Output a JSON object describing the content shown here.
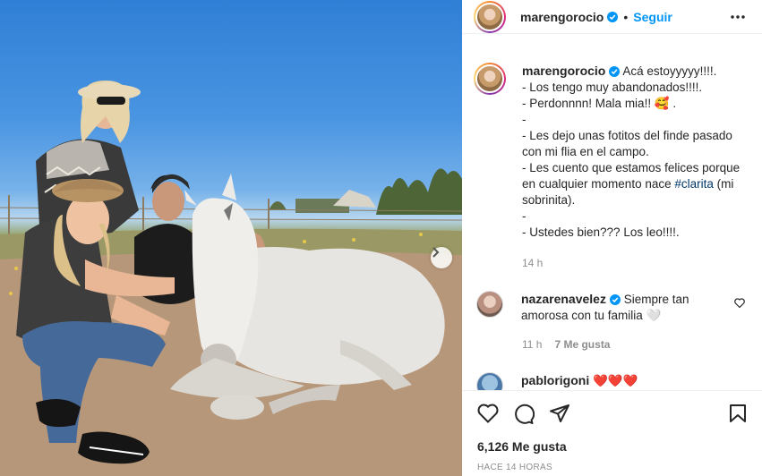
{
  "post": {
    "username": "marengorocio",
    "follow_label": "Seguir",
    "separator": "•",
    "caption_lines": [
      "Acá estoyyyyy!!!!.",
      "- Los tengo muy abandonados!!!!.",
      "- Perdonnnn! Mala mia!! 🥰 .",
      "-",
      "- Les dejo unas fotitos del finde pasado con mi flia en el campo.",
      "- Les cuento que estamos felices porque en cualquier momento nace ",
      "-",
      "- Ustedes bien??? Los leo!!!!."
    ],
    "hashtag": "#clarita",
    "caption_after_hashtag": " (mi sobrinita).",
    "caption_time": "14 h"
  },
  "comments": [
    {
      "username": "nazarenavelez",
      "text": "Siempre tan amorosa con tu familia 🤍",
      "time": "11 h",
      "likes": "7 Me gusta"
    },
    {
      "username": "pablorigoni",
      "text": "❤️❤️❤️"
    }
  ],
  "footer": {
    "likes": "6,126 Me gusta",
    "time_ago": "HACE 14 HORAS"
  },
  "icons": {
    "header": [
      "verified-icon",
      "more-options-icon"
    ],
    "actions": [
      "like-icon",
      "comment-icon",
      "share-icon",
      "save-icon"
    ],
    "carousel": "chevron-right-icon"
  },
  "colors": {
    "link_blue": "#0095f6",
    "verified_blue": "#0095f6",
    "meta_gray": "#8e8e8e",
    "hashtag": "#00376b"
  }
}
